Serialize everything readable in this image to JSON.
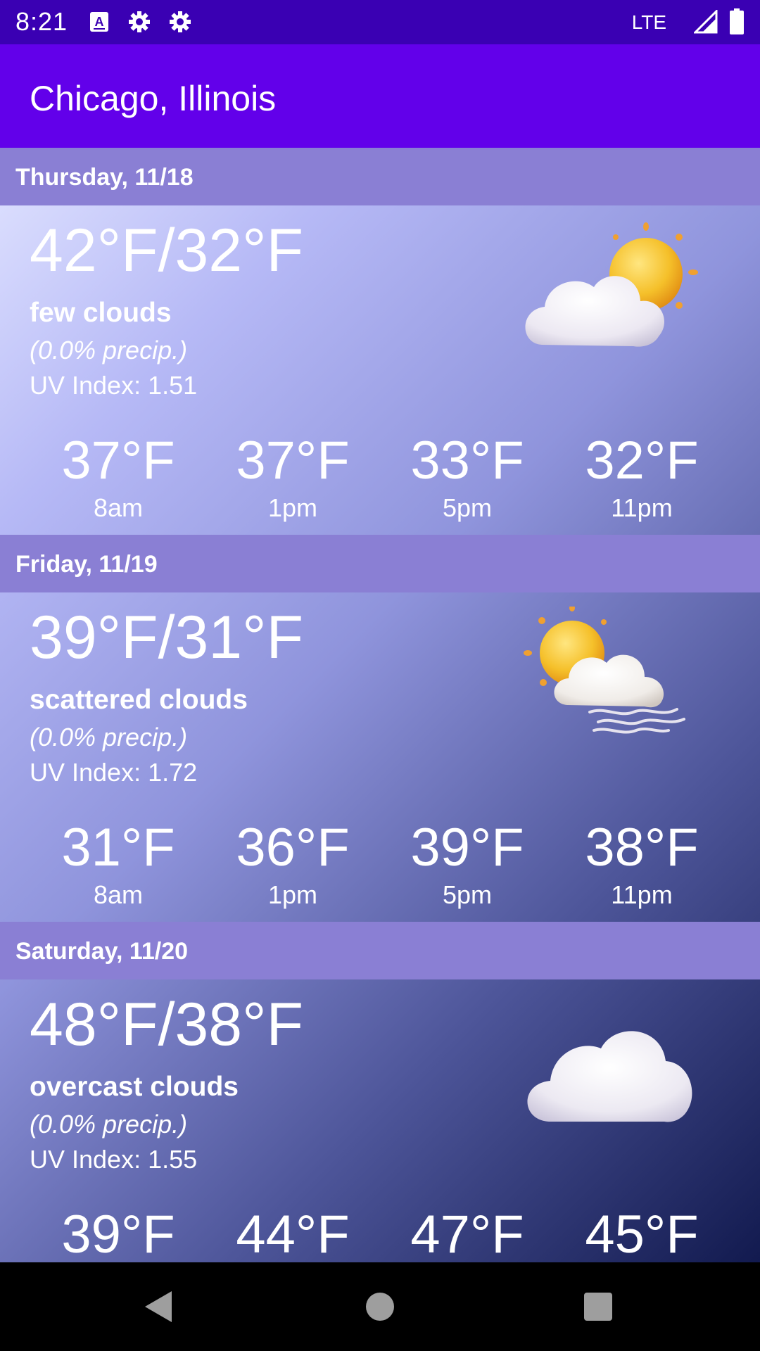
{
  "status_bar": {
    "time": "8:21",
    "network": "LTE",
    "icons": [
      "a-square-icon",
      "gear-icon",
      "gear-icon",
      "signal-icon",
      "battery-icon"
    ]
  },
  "app_bar": {
    "title": "Chicago, Illinois",
    "color": "#6200ea"
  },
  "days": [
    {
      "header": "Thursday, 11/18",
      "temp_range": "42°F/32°F",
      "condition": "few clouds",
      "precip": "(0.0% precip.)",
      "uv": "UV Index: 1.51",
      "icon": "sun-behind-cloud-icon",
      "hourly": [
        {
          "temp": "37°F",
          "time": "8am"
        },
        {
          "temp": "37°F",
          "time": "1pm"
        },
        {
          "temp": "33°F",
          "time": "5pm"
        },
        {
          "temp": "32°F",
          "time": "11pm"
        }
      ]
    },
    {
      "header": "Friday, 11/19",
      "temp_range": "39°F/31°F",
      "condition": "scattered clouds",
      "precip": "(0.0% precip.)",
      "uv": "UV Index: 1.72",
      "icon": "sun-cloud-wind-icon",
      "hourly": [
        {
          "temp": "31°F",
          "time": "8am"
        },
        {
          "temp": "36°F",
          "time": "1pm"
        },
        {
          "temp": "39°F",
          "time": "5pm"
        },
        {
          "temp": "38°F",
          "time": "11pm"
        }
      ]
    },
    {
      "header": "Saturday, 11/20",
      "temp_range": "48°F/38°F",
      "condition": "overcast clouds",
      "precip": "(0.0% precip.)",
      "uv": "UV Index: 1.55",
      "icon": "cloud-icon",
      "hourly": [
        {
          "temp": "39°F",
          "time": ""
        },
        {
          "temp": "44°F",
          "time": ""
        },
        {
          "temp": "47°F",
          "time": ""
        },
        {
          "temp": "45°F",
          "time": ""
        }
      ]
    }
  ],
  "nav_bar": {
    "buttons": [
      "back-icon",
      "home-icon",
      "recents-icon"
    ]
  }
}
